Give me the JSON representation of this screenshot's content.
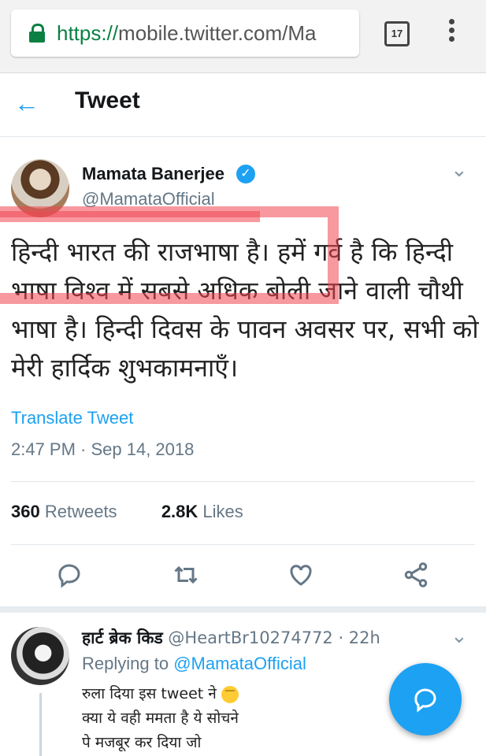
{
  "browser": {
    "url_scheme": "https://",
    "url_rest": "mobile.twitter.com/Ma",
    "tab_count": "17"
  },
  "header": {
    "title": "Tweet"
  },
  "tweet": {
    "author_name": "Mamata Banerjee",
    "author_handle": "@MamataOfficial",
    "text": "हिन्दी भारत की राजभाषा है। हमें गर्व है कि हिन्दी भाषा विश्व में सबसे अधिक बोली जाने वाली चौथी भाषा है। हिन्दी दिवस के पावन अवसर पर, सभी को मेरी हार्दिक शुभकामनाएँ।",
    "translate_label": "Translate Tweet",
    "timestamp": "2:47 PM · Sep 14, 2018",
    "retweets_count": "360",
    "retweets_label": "Retweets",
    "likes_count": "2.8K",
    "likes_label": "Likes"
  },
  "reply": {
    "author_name": "हार्ट ब्रेक किड",
    "author_handle": "@HeartBr10274772 · 22h",
    "replying_prefix": "Replying to",
    "replying_handle": "@MamataOfficial",
    "line1": "रुला दिया इस tweet ने",
    "line2": "क्या ये वही ममता है ये सोचने",
    "line3": "पे मजबूर कर दिया जो"
  },
  "colors": {
    "accent": "#1da1f2",
    "secure": "#0b8043",
    "highlight": "#f04650"
  },
  "icons": [
    "lock-icon",
    "back-arrow-icon",
    "verified-icon",
    "chevron-down-icon",
    "reply-icon",
    "retweet-icon",
    "like-icon",
    "share-icon",
    "compose-reply-icon"
  ]
}
